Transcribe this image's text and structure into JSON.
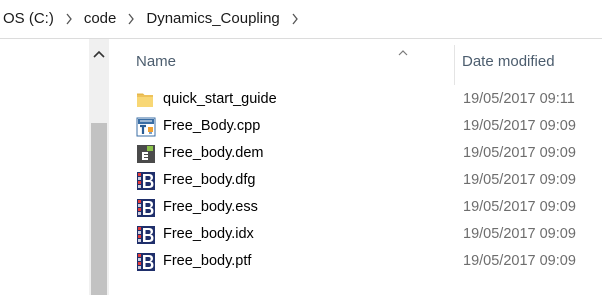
{
  "breadcrumb": {
    "items": [
      "OS (C:)",
      "code",
      "Dynamics_Coupling"
    ]
  },
  "columns": {
    "name": "Name",
    "date_modified": "Date modified"
  },
  "files": [
    {
      "name": "quick_start_guide",
      "date": "19/05/2017 09:11",
      "icon": "folder-icon"
    },
    {
      "name": "Free_Body.cpp",
      "date": "19/05/2017 09:09",
      "icon": "cpp-file-icon"
    },
    {
      "name": "Free_body.dem",
      "date": "19/05/2017 09:09",
      "icon": "dem-file-icon"
    },
    {
      "name": "Free_body.dfg",
      "date": "19/05/2017 09:09",
      "icon": "b-file-icon"
    },
    {
      "name": "Free_body.ess",
      "date": "19/05/2017 09:09",
      "icon": "b-file-icon"
    },
    {
      "name": "Free_body.idx",
      "date": "19/05/2017 09:09",
      "icon": "b-file-icon"
    },
    {
      "name": "Free_body.ptf",
      "date": "19/05/2017 09:09",
      "icon": "b-file-icon"
    }
  ],
  "colors": {
    "folder": "#f8d775",
    "header_text": "#4c5d6e",
    "date_text": "#6d6d6d",
    "scroll_thumb": "#c2c2c2"
  }
}
